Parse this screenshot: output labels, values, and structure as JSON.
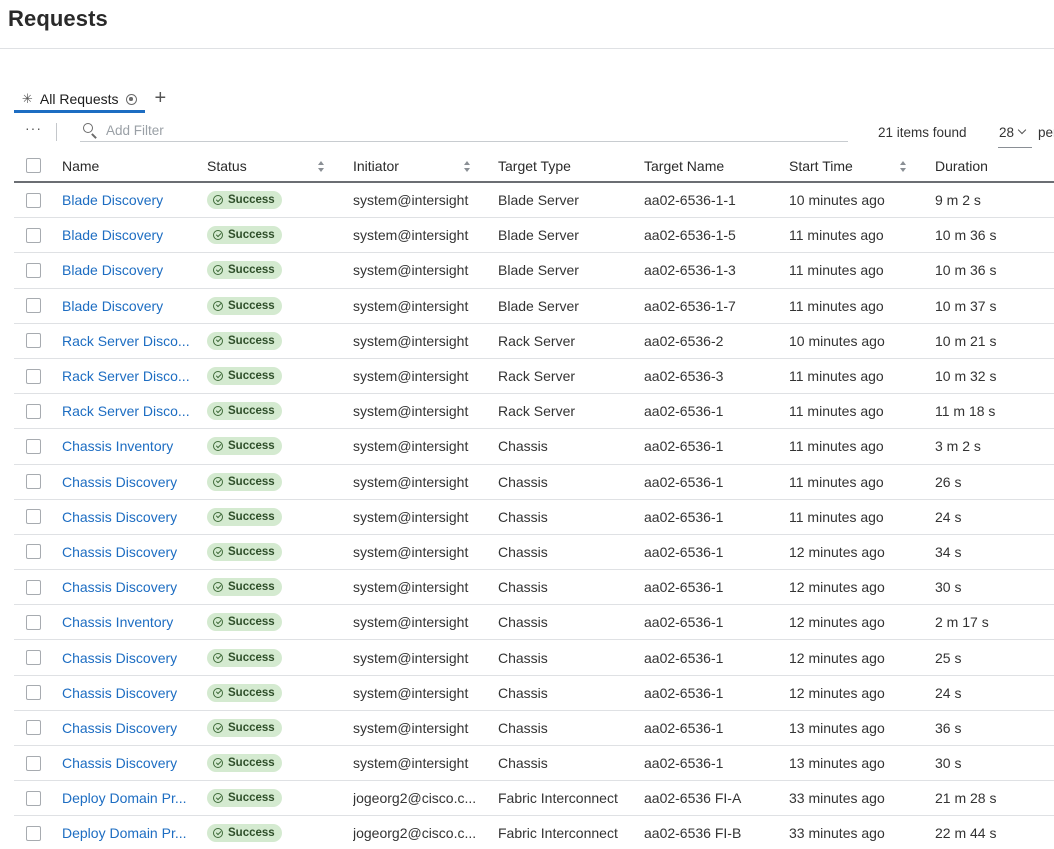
{
  "page": {
    "title": "Requests"
  },
  "tabs": [
    {
      "label": "All Requests"
    }
  ],
  "toolbar": {
    "more_label": "···",
    "filter_placeholder": "Add Filter",
    "items_found": "21 items found",
    "per_page_value": "28",
    "per_page_label": "per page"
  },
  "columns": {
    "name": "Name",
    "status": "Status",
    "initiator": "Initiator",
    "target_type": "Target Type",
    "target_name": "Target Name",
    "start_time": "Start Time",
    "duration": "Duration"
  },
  "colors": {
    "accent": "#1d6dc2",
    "success_bg": "#d4ead0",
    "success_text": "#2f4f2a"
  },
  "rows": [
    {
      "name": "Blade Discovery",
      "status": "Success",
      "initiator": "system@intersight",
      "target_type": "Blade Server",
      "target_name": "aa02-6536-1-1",
      "start_time": "10 minutes ago",
      "duration": "9 m 2 s"
    },
    {
      "name": "Blade Discovery",
      "status": "Success",
      "initiator": "system@intersight",
      "target_type": "Blade Server",
      "target_name": "aa02-6536-1-5",
      "start_time": "11 minutes ago",
      "duration": "10 m 36 s"
    },
    {
      "name": "Blade Discovery",
      "status": "Success",
      "initiator": "system@intersight",
      "target_type": "Blade Server",
      "target_name": "aa02-6536-1-3",
      "start_time": "11 minutes ago",
      "duration": "10 m 36 s"
    },
    {
      "name": "Blade Discovery",
      "status": "Success",
      "initiator": "system@intersight",
      "target_type": "Blade Server",
      "target_name": "aa02-6536-1-7",
      "start_time": "11 minutes ago",
      "duration": "10 m 37 s"
    },
    {
      "name": "Rack Server Disco...",
      "status": "Success",
      "initiator": "system@intersight",
      "target_type": "Rack Server",
      "target_name": "aa02-6536-2",
      "start_time": "10 minutes ago",
      "duration": "10 m 21 s"
    },
    {
      "name": "Rack Server Disco...",
      "status": "Success",
      "initiator": "system@intersight",
      "target_type": "Rack Server",
      "target_name": "aa02-6536-3",
      "start_time": "11 minutes ago",
      "duration": "10 m 32 s"
    },
    {
      "name": "Rack Server Disco...",
      "status": "Success",
      "initiator": "system@intersight",
      "target_type": "Rack Server",
      "target_name": "aa02-6536-1",
      "start_time": "11 minutes ago",
      "duration": "11 m 18 s"
    },
    {
      "name": "Chassis Inventory",
      "status": "Success",
      "initiator": "system@intersight",
      "target_type": "Chassis",
      "target_name": "aa02-6536-1",
      "start_time": "11 minutes ago",
      "duration": "3 m 2 s"
    },
    {
      "name": "Chassis Discovery",
      "status": "Success",
      "initiator": "system@intersight",
      "target_type": "Chassis",
      "target_name": "aa02-6536-1",
      "start_time": "11 minutes ago",
      "duration": "26 s"
    },
    {
      "name": "Chassis Discovery",
      "status": "Success",
      "initiator": "system@intersight",
      "target_type": "Chassis",
      "target_name": "aa02-6536-1",
      "start_time": "11 minutes ago",
      "duration": "24 s"
    },
    {
      "name": "Chassis Discovery",
      "status": "Success",
      "initiator": "system@intersight",
      "target_type": "Chassis",
      "target_name": "aa02-6536-1",
      "start_time": "12 minutes ago",
      "duration": "34 s"
    },
    {
      "name": "Chassis Discovery",
      "status": "Success",
      "initiator": "system@intersight",
      "target_type": "Chassis",
      "target_name": "aa02-6536-1",
      "start_time": "12 minutes ago",
      "duration": "30 s"
    },
    {
      "name": "Chassis Inventory",
      "status": "Success",
      "initiator": "system@intersight",
      "target_type": "Chassis",
      "target_name": "aa02-6536-1",
      "start_time": "12 minutes ago",
      "duration": "2 m 17 s"
    },
    {
      "name": "Chassis Discovery",
      "status": "Success",
      "initiator": "system@intersight",
      "target_type": "Chassis",
      "target_name": "aa02-6536-1",
      "start_time": "12 minutes ago",
      "duration": "25 s"
    },
    {
      "name": "Chassis Discovery",
      "status": "Success",
      "initiator": "system@intersight",
      "target_type": "Chassis",
      "target_name": "aa02-6536-1",
      "start_time": "12 minutes ago",
      "duration": "24 s"
    },
    {
      "name": "Chassis Discovery",
      "status": "Success",
      "initiator": "system@intersight",
      "target_type": "Chassis",
      "target_name": "aa02-6536-1",
      "start_time": "13 minutes ago",
      "duration": "36 s"
    },
    {
      "name": "Chassis Discovery",
      "status": "Success",
      "initiator": "system@intersight",
      "target_type": "Chassis",
      "target_name": "aa02-6536-1",
      "start_time": "13 minutes ago",
      "duration": "30 s"
    },
    {
      "name": "Deploy Domain Pr...",
      "status": "Success",
      "initiator": "jogeorg2@cisco.c...",
      "target_type": "Fabric Interconnect",
      "target_name": "aa02-6536 FI-A",
      "start_time": "33 minutes ago",
      "duration": "21 m 28 s"
    },
    {
      "name": "Deploy Domain Pr...",
      "status": "Success",
      "initiator": "jogeorg2@cisco.c...",
      "target_type": "Fabric Interconnect",
      "target_name": "aa02-6536 FI-B",
      "start_time": "33 minutes ago",
      "duration": "22 m 44 s"
    }
  ]
}
